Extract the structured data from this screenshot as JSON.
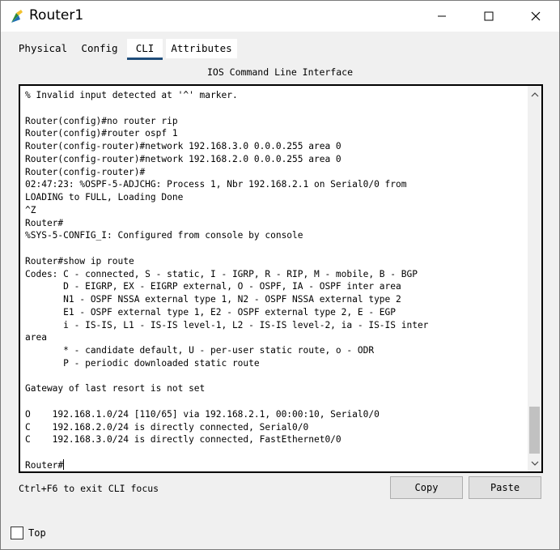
{
  "window": {
    "title": "Router1",
    "icon": "router-app-icon"
  },
  "tabs": [
    {
      "label": "Physical",
      "selected": false
    },
    {
      "label": "Config",
      "selected": false
    },
    {
      "label": "CLI",
      "selected": true
    },
    {
      "label": "Attributes",
      "selected": false
    }
  ],
  "cli": {
    "title": "IOS Command Line Interface",
    "lines": [
      "% Invalid input detected at '^' marker.",
      "",
      "Router(config)#no router rip",
      "Router(config)#router ospf 1",
      "Router(config-router)#network 192.168.3.0 0.0.0.255 area 0",
      "Router(config-router)#network 192.168.2.0 0.0.0.255 area 0",
      "Router(config-router)#",
      "02:47:23: %OSPF-5-ADJCHG: Process 1, Nbr 192.168.2.1 on Serial0/0 from",
      "LOADING to FULL, Loading Done",
      "^Z",
      "Router#",
      "%SYS-5-CONFIG_I: Configured from console by console",
      "",
      "Router#show ip route",
      "Codes: C - connected, S - static, I - IGRP, R - RIP, M - mobile, B - BGP",
      "       D - EIGRP, EX - EIGRP external, O - OSPF, IA - OSPF inter area",
      "       N1 - OSPF NSSA external type 1, N2 - OSPF NSSA external type 2",
      "       E1 - OSPF external type 1, E2 - OSPF external type 2, E - EGP",
      "       i - IS-IS, L1 - IS-IS level-1, L2 - IS-IS level-2, ia - IS-IS inter",
      "area",
      "       * - candidate default, U - per-user static route, o - ODR",
      "       P - periodic downloaded static route",
      "",
      "Gateway of last resort is not set",
      "",
      "O    192.168.1.0/24 [110/65] via 192.168.2.1, 00:00:10, Serial0/0",
      "C    192.168.2.0/24 is directly connected, Serial0/0",
      "C    192.168.3.0/24 is directly connected, FastEthernet0/0",
      "",
      "Router#"
    ],
    "hint": "Ctrl+F6 to exit CLI focus",
    "copy_label": "Copy",
    "paste_label": "Paste"
  },
  "footer": {
    "top_label": "Top",
    "top_checked": false
  }
}
